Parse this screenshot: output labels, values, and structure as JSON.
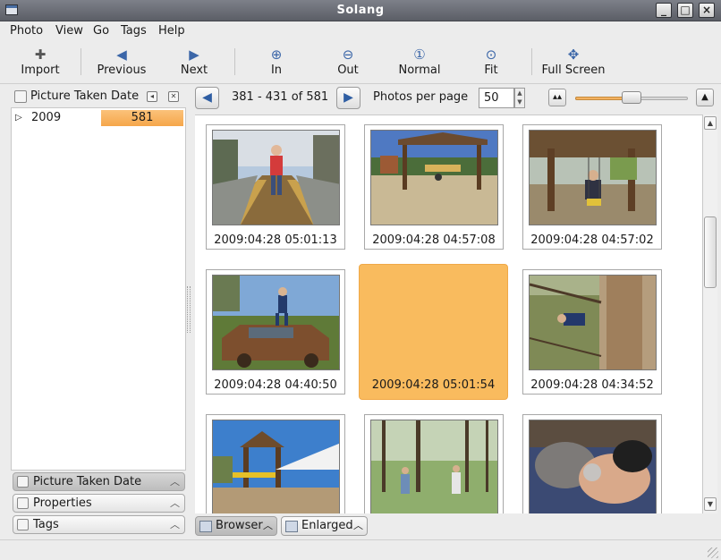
{
  "window": {
    "title": "Solang"
  },
  "menu": [
    "Photo",
    "View",
    "Go",
    "Tags",
    "Help"
  ],
  "toolbar": {
    "import": "Import",
    "previous": "Previous",
    "next": "Next",
    "zoom_in": "In",
    "zoom_out": "Out",
    "normal": "Normal",
    "fit": "Fit",
    "fullscreen": "Full Screen"
  },
  "left_panel": {
    "header": "Picture Taken Date",
    "tree": [
      {
        "label": "2009",
        "count": "581"
      }
    ],
    "panel_buttons": [
      "Picture Taken Date",
      "Properties",
      "Tags"
    ]
  },
  "navigation": {
    "range": "381 - 431 of 581",
    "photos_per_page_label": "Photos per page",
    "photos_per_page": "50",
    "zoom_level": 0.5
  },
  "photos": [
    {
      "caption": "2009:04:28 05:01:13",
      "scene": "bridge",
      "selected": false
    },
    {
      "caption": "2009:04:28 04:57:08",
      "scene": "playground",
      "selected": false
    },
    {
      "caption": "2009:04:28 04:57:02",
      "scene": "swing",
      "selected": false
    },
    {
      "caption": "2009:04:28 04:40:50",
      "scene": "car",
      "selected": false
    },
    {
      "caption": "2009:04:28 05:01:54",
      "scene": "none",
      "selected": true
    },
    {
      "caption": "2009:04:28 04:34:52",
      "scene": "tree",
      "selected": false
    },
    {
      "caption": "",
      "scene": "tent",
      "selected": false
    },
    {
      "caption": "",
      "scene": "forest",
      "selected": false
    },
    {
      "caption": "",
      "scene": "cat",
      "selected": false
    }
  ],
  "bottom_tabs": [
    "Browser",
    "Enlarged"
  ],
  "colors": {
    "selection": "#f9bb5e",
    "accent_blue": "#3b66a8"
  }
}
